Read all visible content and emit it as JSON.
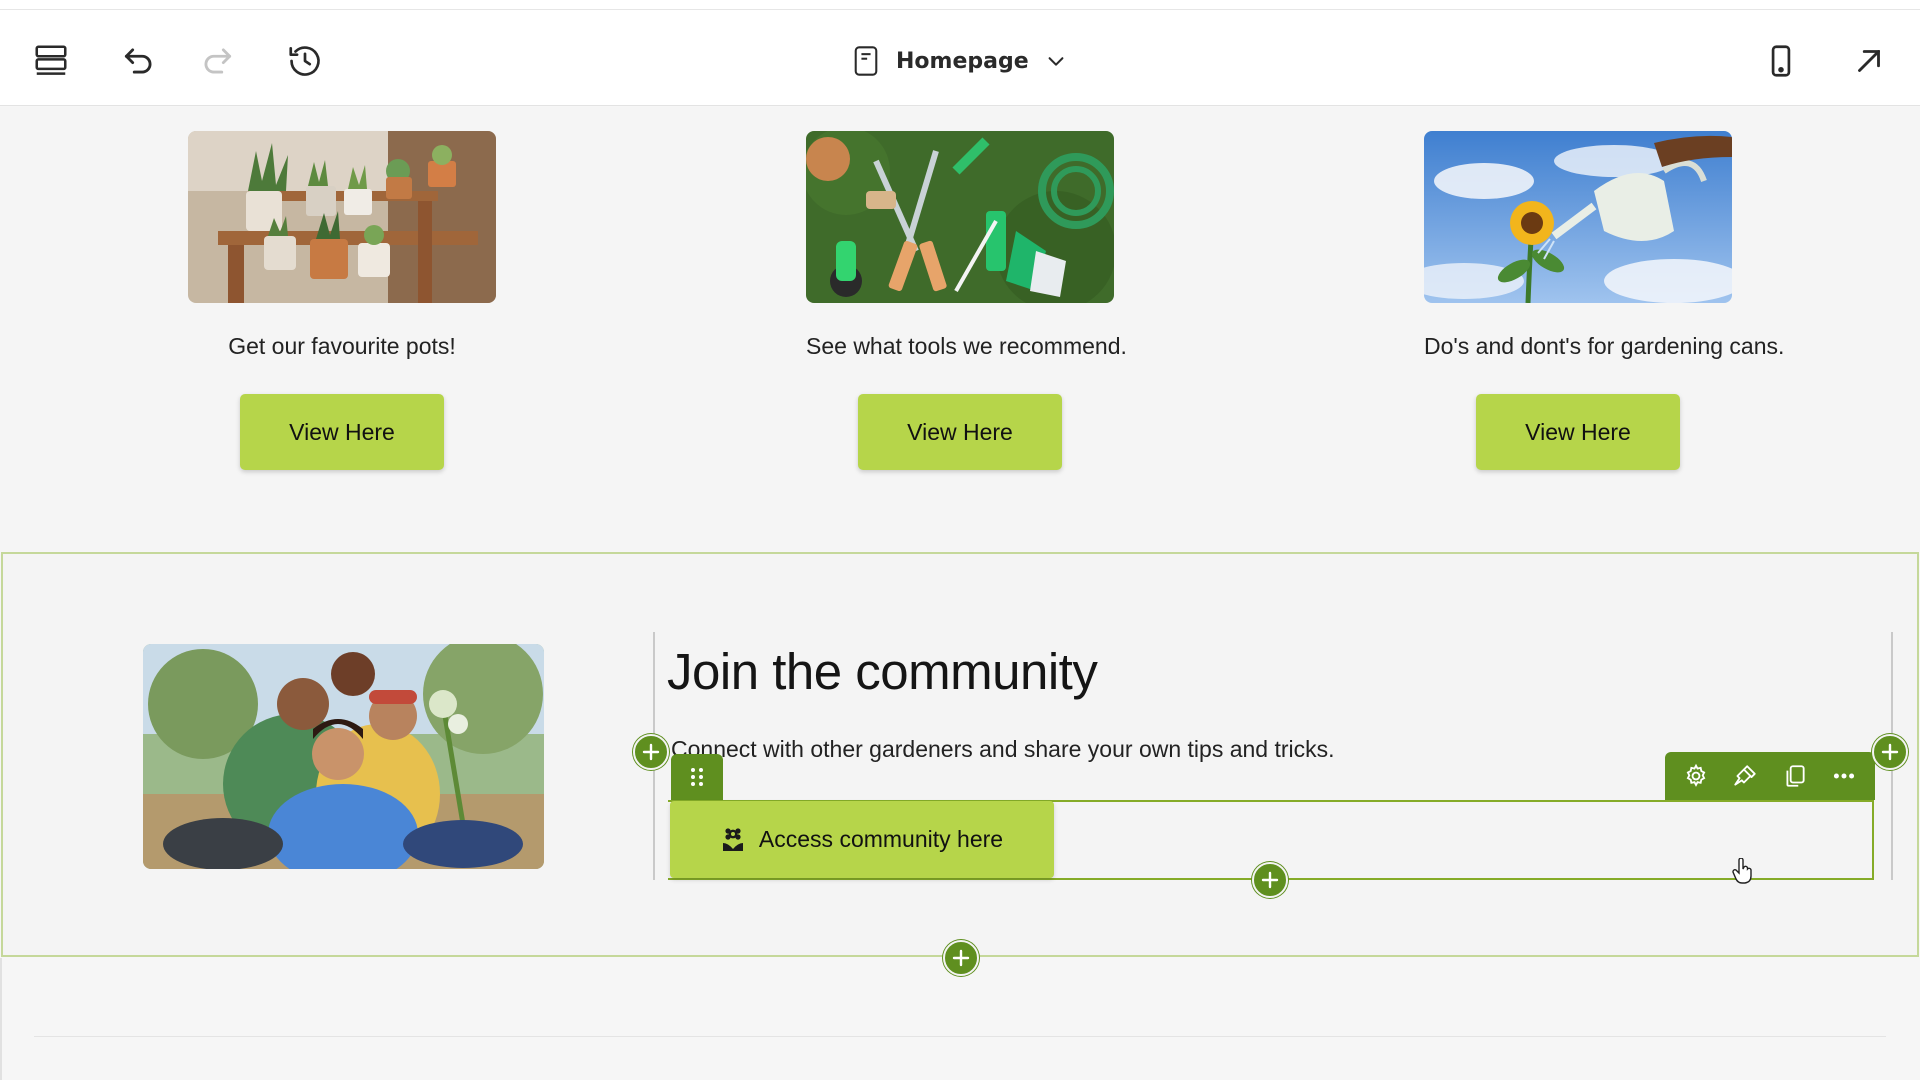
{
  "toolbar": {
    "page_title": "Homepage",
    "icons": [
      "layers-icon",
      "undo-icon",
      "redo-icon",
      "history-icon",
      "page-icon",
      "chevron-down-icon",
      "mobile-preview-icon",
      "open-external-icon"
    ]
  },
  "cards": [
    {
      "image": "potted-plants-photo",
      "caption": "Get our favourite pots!",
      "button": "View Here"
    },
    {
      "image": "garden-tools-photo",
      "caption": "See what tools we recommend.",
      "button": "View Here"
    },
    {
      "image": "watering-can-sunflower-photo",
      "caption": "Do's and dont's for gardening cans.",
      "button": "View Here"
    }
  ],
  "community": {
    "image": "friends-group-photo",
    "title": "Join the community",
    "body": "Connect with other gardeners and share your own tips and tricks.",
    "button": "Access community here",
    "button_icon": "flower-icon"
  },
  "element_toolbar": {
    "icons": [
      "settings-icon",
      "design-icon",
      "duplicate-icon",
      "more-icon"
    ]
  },
  "colors": {
    "accent_button": "#b6d54a",
    "editor_green": "#5f8f1f",
    "selection_border": "#85ab28",
    "section_border": "#c5d89a"
  }
}
